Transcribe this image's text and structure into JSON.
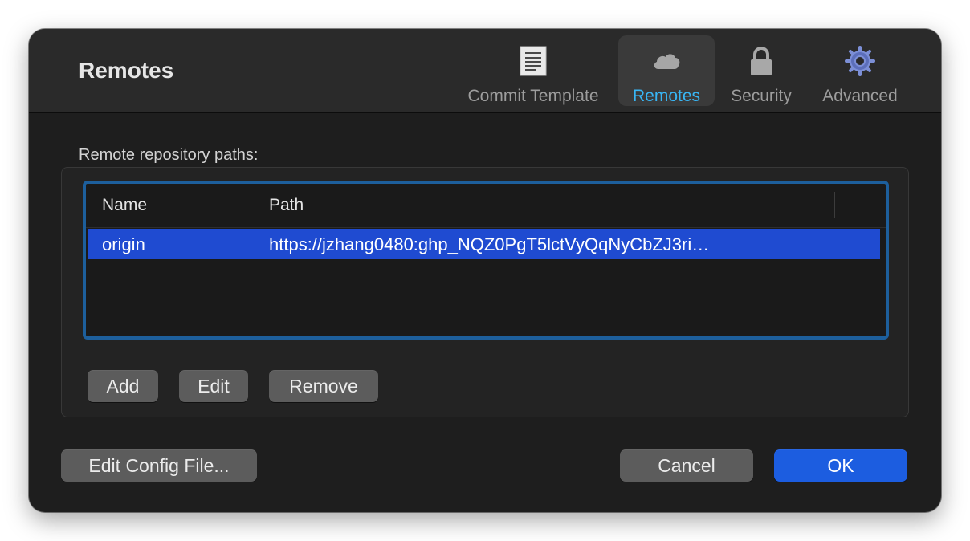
{
  "window": {
    "title": "Remotes"
  },
  "tabs": [
    {
      "label": "Commit Template",
      "icon": "document-icon",
      "selected": false
    },
    {
      "label": "Remotes",
      "icon": "cloud-icon",
      "selected": true
    },
    {
      "label": "Security",
      "icon": "lock-icon",
      "selected": false
    },
    {
      "label": "Advanced",
      "icon": "gear-icon",
      "selected": false
    }
  ],
  "remotes": {
    "section_label": "Remote repository paths:",
    "columns": {
      "name": "Name",
      "path": "Path"
    },
    "rows": [
      {
        "name": "origin",
        "path": "https://jzhang0480:ghp_NQZ0PgT5lctVyQqNyCbZJ3ri…",
        "selected": true
      }
    ],
    "add_label": "Add",
    "edit_label": "Edit",
    "remove_label": "Remove"
  },
  "footer": {
    "edit_config_label": "Edit Config File...",
    "cancel_label": "Cancel",
    "ok_label": "OK"
  },
  "colors": {
    "accent": "#38b6f5",
    "selection": "#1f4bd1",
    "primary_button": "#1c5de0",
    "focus_ring": "#1d5f9c"
  }
}
